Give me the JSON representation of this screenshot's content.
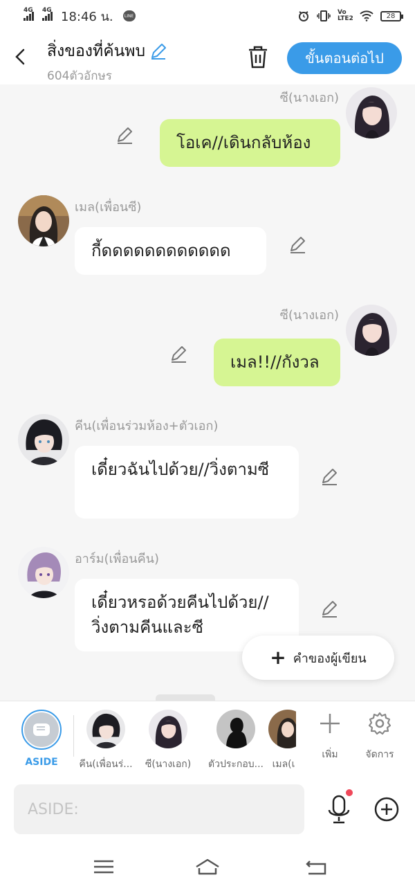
{
  "status_bar": {
    "sig1": "4G",
    "sig2": "4G",
    "time": "18:46 น.",
    "line_badge": "LINE",
    "volte": "Vo LTE2",
    "battery": "28"
  },
  "header": {
    "title": "สิ่งของที่ค้นพบ",
    "subtitle": "604ตัวอักษร",
    "next_label": "ขั้นตอนต่อไป"
  },
  "messages": [
    {
      "name": "ซี(นางเอก)",
      "text": "โอเค//เดินกลับห้อง",
      "side": "right",
      "avatar": "girl-dark"
    },
    {
      "name": "เมล(เพื่อนซี)",
      "text": "กี้ดดดดดดดดดดดด",
      "side": "left",
      "avatar": "girl-cafe"
    },
    {
      "name": "ซี(นางเอก)",
      "text": "เมล!!//กังวล",
      "side": "right",
      "avatar": "girl-dark"
    },
    {
      "name": "คีน(เพื่อนร่วมห้อง+ตัวเอก)",
      "text": "เดี๋ยวฉันไปด้วย//วิ่งตามซี",
      "side": "left",
      "avatar": "boy-dark"
    },
    {
      "name": "อาร์ม(เพื่อนคีน)",
      "text": "เดี๋ยวหรอด้วยคีนไปด้วย//วิ่งตามคีนและซี",
      "side": "left",
      "avatar": "boy-purple"
    }
  ],
  "writer_button": {
    "label": "คำของผู้เขียน"
  },
  "characters": {
    "aside": "ASIDE",
    "c1": "คีน(เพื่อนร่...",
    "c2": "ซี(นางเอก)",
    "c3": "ตัวประกอบ...",
    "c4": "เมล(เ",
    "add": "เพิ่ม",
    "manage": "จัดการ"
  },
  "input": {
    "placeholder": "ASIDE:"
  },
  "colors": {
    "accent": "#3a9be8",
    "green_bubble": "#d6f593",
    "notify": "#f0485a"
  }
}
